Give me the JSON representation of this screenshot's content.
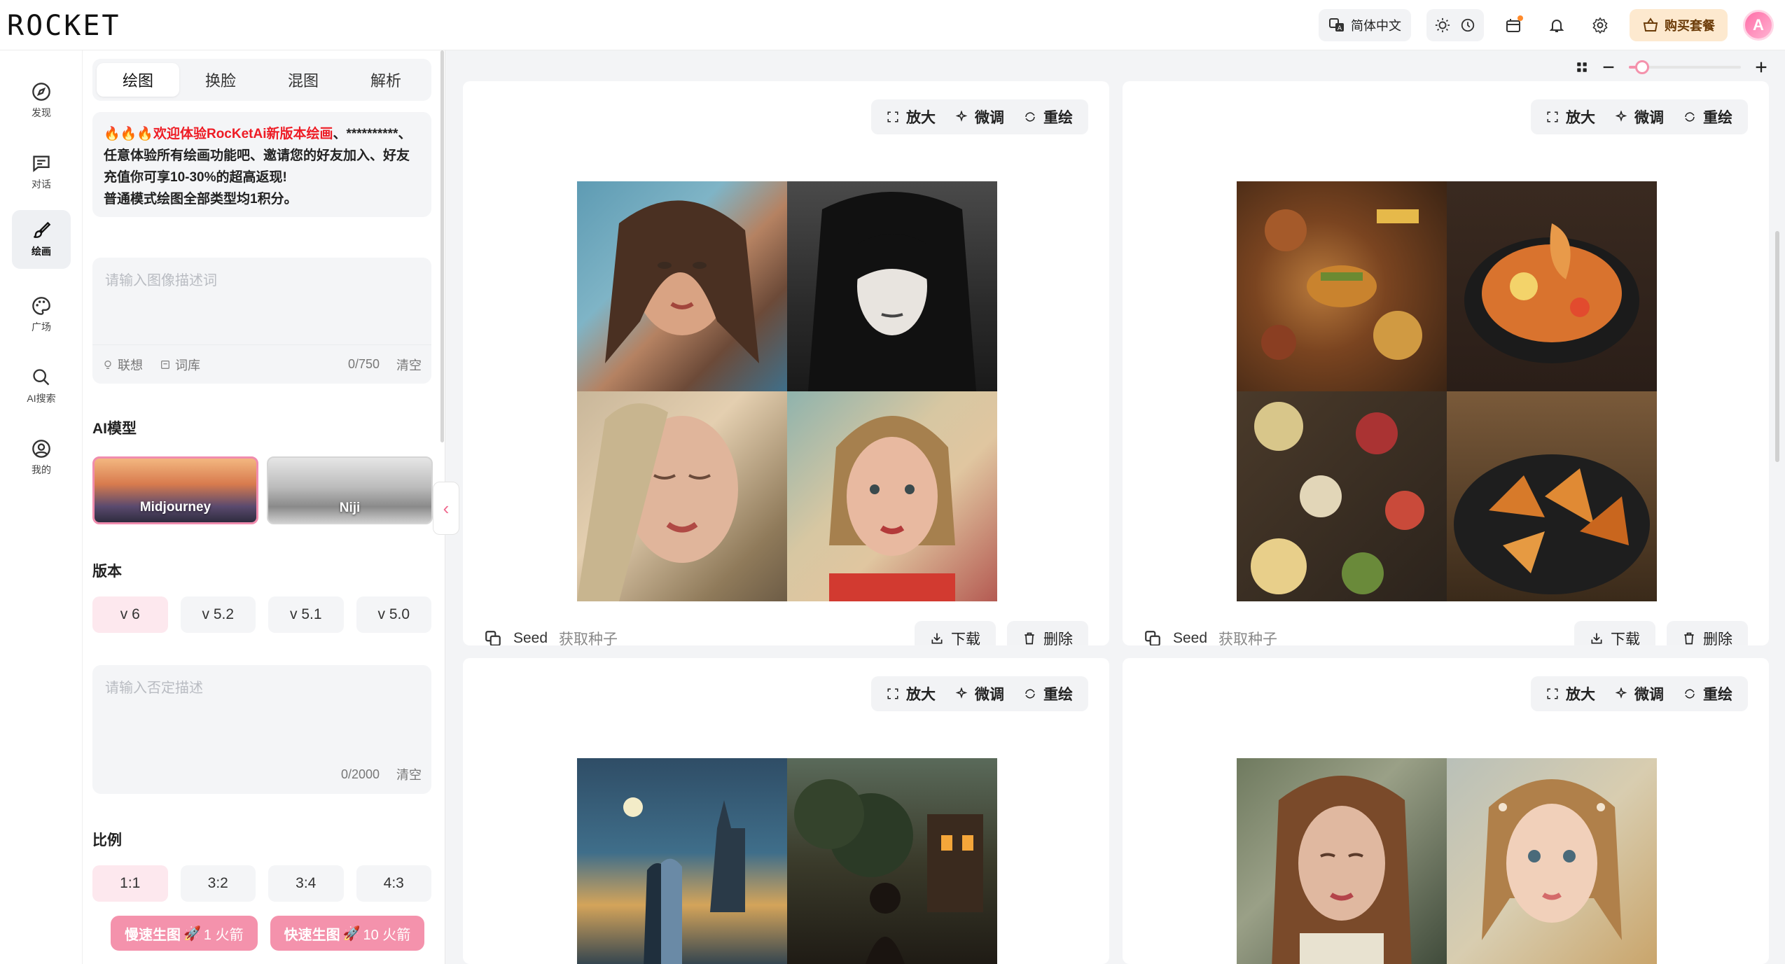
{
  "app": {
    "logo": "ROCKET"
  },
  "header": {
    "language": "简体中文",
    "buy_label": "购买套餐",
    "avatar_initial": "A"
  },
  "leftnav": {
    "items": [
      {
        "label": "发现",
        "icon": "compass-icon"
      },
      {
        "label": "对话",
        "icon": "chat-icon"
      },
      {
        "label": "绘画",
        "icon": "brush-icon",
        "active": true
      },
      {
        "label": "广场",
        "icon": "palette-icon"
      },
      {
        "label": "AI搜索",
        "icon": "search-icon"
      },
      {
        "label": "我的",
        "icon": "user-icon"
      }
    ]
  },
  "panel": {
    "tabs": [
      "绘图",
      "换脸",
      "混图",
      "解析"
    ],
    "active_tab": "绘图",
    "promo": {
      "emoji": "🔥🔥🔥",
      "highlight": "欢迎体验RocKetAi新版本绘画",
      "text1": "、**********、任意体验所有绘画功能吧、邀请您的好友加入、好友充值你可享10-30%的超高返现!",
      "text2": "普通模式绘图全部类型均1积分。"
    },
    "prompt": {
      "placeholder": "请输入图像描述词",
      "assoc_label": "联想",
      "lexicon_label": "词库",
      "count": "0/750",
      "clear_label": "清空"
    },
    "model_section_title": "AI模型",
    "models": [
      "Midjourney",
      "Niji"
    ],
    "version_section_title": "版本",
    "versions": [
      "v 6",
      "v 5.2",
      "v 5.1",
      "v 5.0"
    ],
    "negative": {
      "placeholder": "请输入否定描述",
      "count": "0/2000",
      "clear_label": "清空"
    },
    "ratio_section_title": "比例",
    "ratios": [
      "1:1",
      "3:2",
      "3:4",
      "4:3"
    ],
    "slow_gen": {
      "label": "慢速生图",
      "cost": "1 火箭"
    },
    "fast_gen": {
      "label": "快速生图",
      "cost": "10 火箭"
    }
  },
  "main": {
    "zoom_level": 0.12,
    "card_actions": {
      "zoom": "放大",
      "tune": "微调",
      "redraw": "重绘"
    },
    "card_bottom": {
      "seed": "Seed",
      "get_seed": "获取种子",
      "download": "下载",
      "delete": "删除"
    },
    "cards": [
      {
        "theme": "portrait-painting"
      },
      {
        "theme": "food"
      },
      {
        "theme": "night-scene"
      },
      {
        "theme": "portrait-girl"
      }
    ]
  },
  "colors": {
    "accent_pink": "#f492ac",
    "promo_red": "#ee1c25",
    "buy_bg": "#fde9cf"
  }
}
